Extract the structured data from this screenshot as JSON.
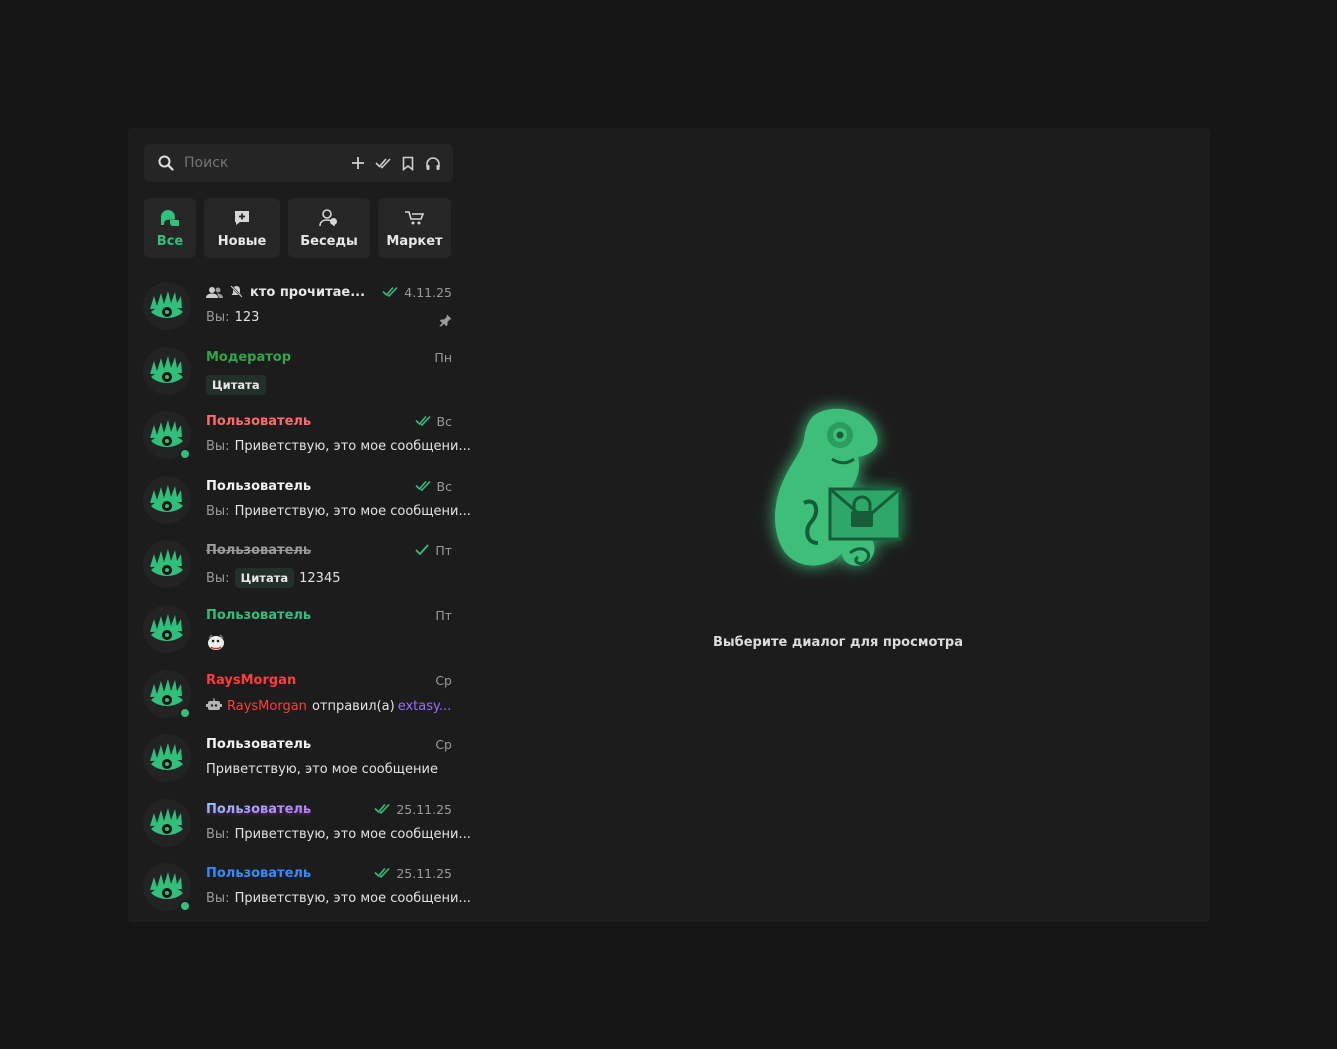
{
  "search": {
    "placeholder": "Поиск"
  },
  "toolbar_icons": [
    "plus-icon",
    "double-check-icon",
    "bookmark-icon",
    "headphones-icon"
  ],
  "filters": [
    {
      "label": "Все",
      "icon": "chats-icon",
      "active": true
    },
    {
      "label": "Новые",
      "icon": "new-message-icon",
      "active": false
    },
    {
      "label": "Беседы",
      "icon": "group-icon",
      "active": false
    },
    {
      "label": "Маркет",
      "icon": "cart-icon",
      "active": false
    }
  ],
  "chats": [
    {
      "name": "кто прочитае...",
      "name_color": "#e6e6e6",
      "prefix": "Вы:",
      "text": "123",
      "time": "4.11.25",
      "read": true,
      "group": true,
      "muted": true,
      "pinned": true,
      "online": false
    },
    {
      "name": "Модератор",
      "name_color": "#2ea64a",
      "quote": "Цитата",
      "time": "Пн",
      "online": false
    },
    {
      "name": "Пользователь",
      "name_color": "#ff6b6b",
      "prefix": "Вы:",
      "text": "Приветствую, это мое сообщени...",
      "time": "Вс",
      "read": true,
      "online": true
    },
    {
      "name": "Пользователь",
      "name_color": "#f2f2f2",
      "prefix": "Вы:",
      "text": "Приветствую, это мое сообщени...",
      "time": "Вс",
      "read": true,
      "online": false
    },
    {
      "name": "Пользователь",
      "name_color": "#9a9a9a",
      "strike": true,
      "prefix": "Вы:",
      "quote": "Цитата",
      "text": "12345",
      "time": "Пт",
      "read_single": true,
      "online": false
    },
    {
      "name": "Пользователь",
      "name_color": "#2fc07a",
      "sticker": true,
      "time": "Пт",
      "online": false
    },
    {
      "name": "RaysMorgan",
      "name_color": "#ff3b3b",
      "bot": true,
      "system_user": "RaysMorgan",
      "system_text": "отправил(а)",
      "system_target": "extasy...",
      "time": "Ср",
      "online": true
    },
    {
      "name": "Пользователь",
      "name_color": "#f2f2f2",
      "text": "Приветствую, это мое сообщение",
      "time": "Ср",
      "online": false
    },
    {
      "name": "Пользователь",
      "name_color": "#9fb4ff",
      "gradient": true,
      "prefix": "Вы:",
      "text": "Приветствую, это мое сообщени...",
      "time": "25.11.25",
      "read": true,
      "online": false
    },
    {
      "name": "Пользователь",
      "name_color": "#2f8dff",
      "prefix": "Вы:",
      "text": "Приветствую, это мое сообщени...",
      "time": "25.11.25",
      "read": true,
      "online": true
    }
  ],
  "empty_state": {
    "label": "Выберите диалог для просмотра"
  },
  "colors": {
    "accent": "#2fc07a",
    "background": "#151515",
    "panel": "#1c1c1c",
    "system_target": "#9b6bff"
  }
}
